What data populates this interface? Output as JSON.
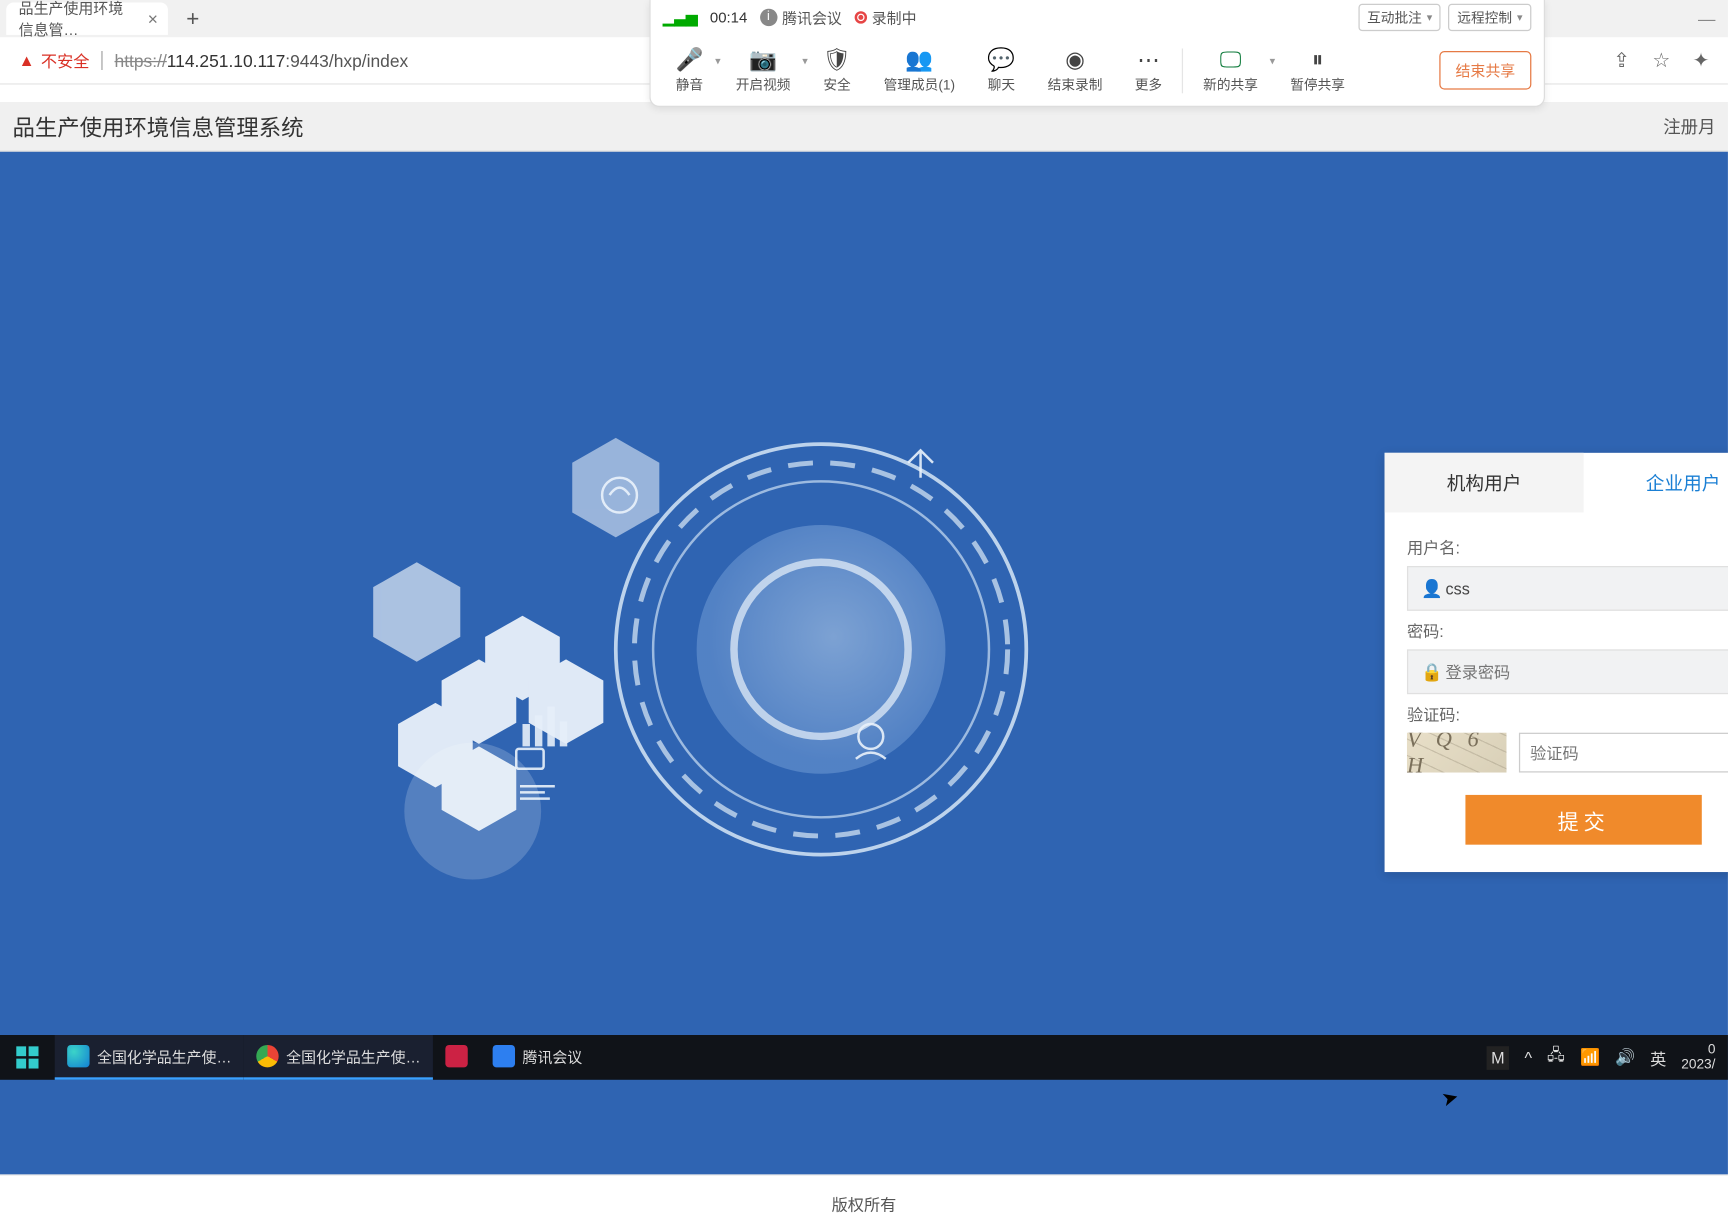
{
  "browser": {
    "tab_title": "品生产使用环境信息管…",
    "insecure_label": "不安全",
    "url_scheme": "https://",
    "url_host": "114.251.10.117",
    "url_port_path": ":9443/hxp/index"
  },
  "meeting": {
    "timer": "00:14",
    "brand": "腾讯会议",
    "recording": "录制中",
    "select1": "互动批注",
    "select2": "远程控制",
    "tools": {
      "mute": "静音",
      "video": "开启视频",
      "security": "安全",
      "members": "管理成员(1)",
      "chat": "聊天",
      "stop_rec": "结束录制",
      "more": "更多",
      "new_share": "新的共享",
      "pause_share": "暂停共享"
    },
    "stop_share_btn": "结束共享"
  },
  "header": {
    "title": "品生产使用环境信息管理系统",
    "register": "注册月"
  },
  "login": {
    "tab_org": "机构用户",
    "tab_ent": "企业用户",
    "username_label": "用户名:",
    "username_value": "css",
    "password_label": "密码:",
    "password_placeholder": "登录密码",
    "captcha_label": "验证码:",
    "captcha_text": "V Q 6 H",
    "captcha_placeholder": "验证码",
    "submit": "提交"
  },
  "footer": {
    "copyright": "版权所有"
  },
  "taskbar": {
    "app1": "全国化学品生产使…",
    "app2": "全国化学品生产使…",
    "app4": "腾讯会议",
    "ime": "英",
    "time_top": "0",
    "time_bottom": "2023/"
  }
}
